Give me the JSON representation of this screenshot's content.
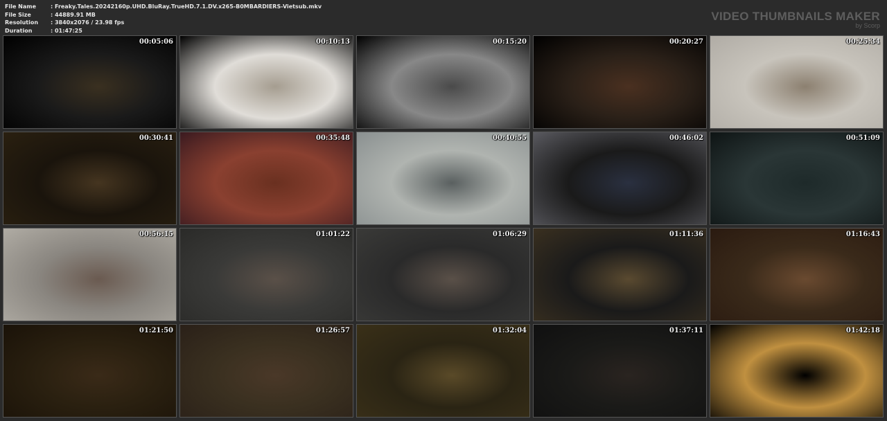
{
  "info": [
    {
      "label": "File Name",
      "value": "Freaky.Tales.20242160p.UHD.BluRay.TrueHD.7.1.DV.x265-B0MBARDIERS-Vietsub.mkv"
    },
    {
      "label": "File Size",
      "value": "44889.91 MB"
    },
    {
      "label": "Resolution",
      "value": "3840x2076 / 23.98 fps"
    },
    {
      "label": "Duration",
      "value": "01:47:25"
    }
  ],
  "brand": {
    "title": "VIDEO THUMBNAILS MAKER",
    "subtitle": "by Scorp"
  },
  "thumbnails": [
    {
      "time": "00:05:06",
      "colors": [
        "#000",
        "#3a3020",
        "#1a1a1a"
      ]
    },
    {
      "time": "00:10:13",
      "colors": [
        "#000",
        "#a59d90",
        "#e0ddd8"
      ]
    },
    {
      "time": "00:15:20",
      "colors": [
        "#000",
        "#4a4a4a",
        "#888"
      ]
    },
    {
      "time": "00:20:27",
      "colors": [
        "#000",
        "#4a3020",
        "#2a2018"
      ]
    },
    {
      "time": "00:25:34",
      "colors": [
        "#b0aca5",
        "#8c8070",
        "#c8c4bc"
      ]
    },
    {
      "time": "00:30:41",
      "colors": [
        "#2a2010",
        "#453520",
        "#1a140c"
      ]
    },
    {
      "time": "00:35:48",
      "colors": [
        "#3a1a20",
        "#6a3020",
        "#8a4030"
      ]
    },
    {
      "time": "00:40:55",
      "colors": [
        "#8a9090",
        "#5a6060",
        "#b0b4b0"
      ]
    },
    {
      "time": "00:46:02",
      "colors": [
        "#5a5a60",
        "#2a3040",
        "#1a1a1a"
      ]
    },
    {
      "time": "00:51:09",
      "colors": [
        "#0e1414",
        "#1e2a2a",
        "#2a3636"
      ]
    },
    {
      "time": "00:56:15",
      "colors": [
        "#b0aca4",
        "#6a5a50",
        "#8a8680"
      ]
    },
    {
      "time": "01:01:22",
      "colors": [
        "#2a2a28",
        "#5a5048",
        "#3a3a38"
      ]
    },
    {
      "time": "01:06:29",
      "colors": [
        "#3a3a38",
        "#5a5048",
        "#2a2a2a"
      ]
    },
    {
      "time": "01:11:36",
      "colors": [
        "#3a3020",
        "#5a4a30",
        "#1a1a1a"
      ]
    },
    {
      "time": "01:16:43",
      "colors": [
        "#2a1a10",
        "#6a4a30",
        "#3a2a1a"
      ]
    },
    {
      "time": "01:21:50",
      "colors": [
        "#1a1208",
        "#3a2a18",
        "#2a2010"
      ]
    },
    {
      "time": "01:26:57",
      "colors": [
        "#2a2018",
        "#4a3828",
        "#3a3020"
      ]
    },
    {
      "time": "01:32:04",
      "colors": [
        "#3a3018",
        "#5a4a28",
        "#2a2414"
      ]
    },
    {
      "time": "01:37:11",
      "colors": [
        "#101010",
        "#2a2420",
        "#1a1a18"
      ]
    },
    {
      "time": "01:42:18",
      "colors": [
        "#000",
        "#000",
        "#c09040"
      ]
    }
  ]
}
